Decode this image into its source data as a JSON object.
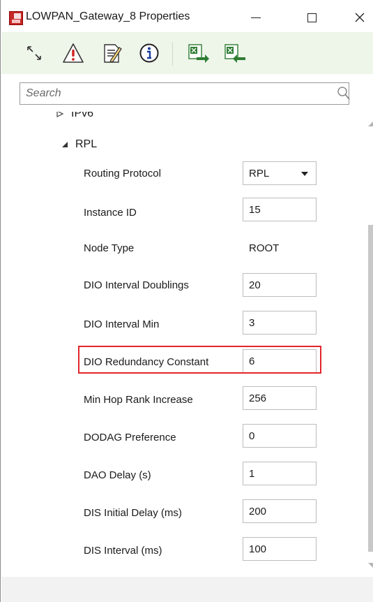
{
  "window": {
    "title": "LOWPAN_Gateway_8 Properties"
  },
  "toolbar": {
    "buttons": [
      {
        "name": "expand-collapse-icon"
      },
      {
        "name": "warning-icon"
      },
      {
        "name": "edit-document-icon"
      },
      {
        "name": "info-icon"
      },
      {
        "name": "excel-export-icon"
      },
      {
        "name": "excel-import-icon"
      }
    ],
    "accent_color": "#eef5e9"
  },
  "search": {
    "placeholder": "Search",
    "value": ""
  },
  "tree": {
    "ipv6_label": "IPv6",
    "rpl_label": "RPL"
  },
  "properties": [
    {
      "label": "Routing Protocol",
      "value": "RPL",
      "kind": "select"
    },
    {
      "label": "Instance ID",
      "value": "15",
      "kind": "input"
    },
    {
      "label": "Node Type",
      "value": "ROOT",
      "kind": "static"
    },
    {
      "label": "DIO Interval Doublings",
      "value": "20",
      "kind": "input"
    },
    {
      "label": "DIO Interval Min",
      "value": "3",
      "kind": "input"
    },
    {
      "label": "DIO Redundancy Constant",
      "value": "6",
      "kind": "input",
      "highlighted": true
    },
    {
      "label": "Min Hop Rank Increase",
      "value": "256",
      "kind": "input"
    },
    {
      "label": "DODAG Preference",
      "value": "0",
      "kind": "input"
    },
    {
      "label": "DAO Delay (s)",
      "value": "1",
      "kind": "input"
    },
    {
      "label": "DIS Initial Delay (ms)",
      "value": "200",
      "kind": "input"
    },
    {
      "label": "DIS Interval (ms)",
      "value": "100",
      "kind": "input"
    }
  ],
  "colors": {
    "highlight": "#e0262b",
    "logo": "#c62828"
  }
}
